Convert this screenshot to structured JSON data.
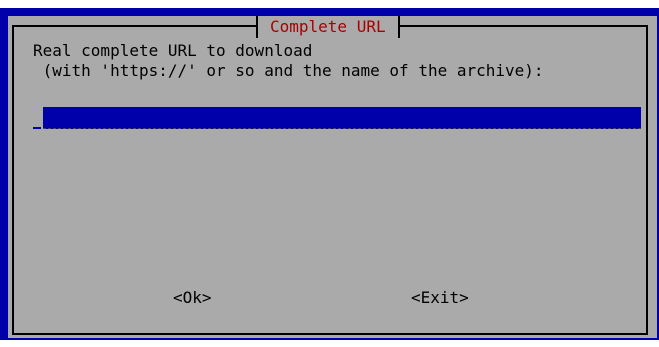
{
  "dialog": {
    "title": "Complete URL",
    "prompt_line1": "Real complete URL to download",
    "prompt_line2": " (with 'https://' or so and the name of the archive):",
    "input": {
      "value": ""
    },
    "buttons": {
      "ok": "<Ok>",
      "exit": "<Exit>"
    }
  },
  "colors": {
    "background": "#0000aa",
    "dialog": "#aaaaaa",
    "title": "#aa0000",
    "input_background": "#0000aa"
  }
}
